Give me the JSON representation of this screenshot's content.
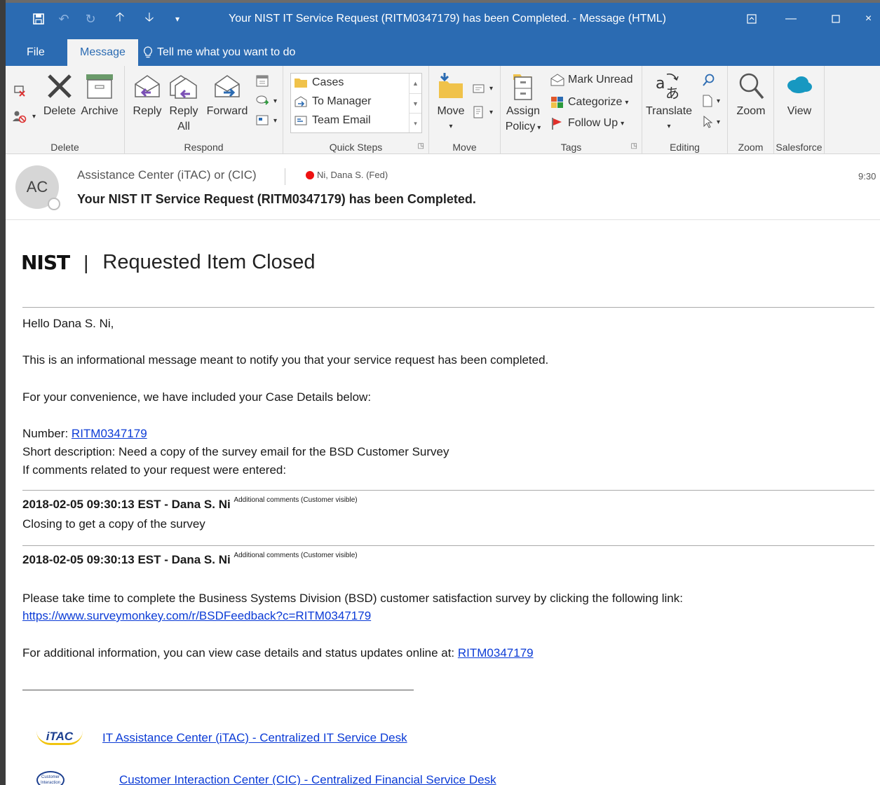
{
  "window": {
    "title": "Your NIST IT Service Request (RITM0347179) has been Completed.  -  Message (HTML)"
  },
  "tabs": {
    "file": "File",
    "message": "Message",
    "tell_me": "Tell me what you want to do"
  },
  "ribbon": {
    "delete_group": {
      "label": "Delete",
      "delete": "Delete",
      "archive": "Archive"
    },
    "respond_group": {
      "label": "Respond",
      "reply": "Reply",
      "reply_all_1": "Reply",
      "reply_all_2": "All",
      "forward": "Forward"
    },
    "quick_steps": {
      "label": "Quick Steps",
      "items": [
        "Cases",
        "To Manager",
        "Team Email"
      ]
    },
    "move_group": {
      "label": "Move",
      "move": "Move"
    },
    "tags_group": {
      "label": "Tags",
      "assign_1": "Assign",
      "assign_2": "Policy",
      "mark_unread": "Mark Unread",
      "categorize": "Categorize",
      "follow_up": "Follow Up"
    },
    "editing_group": {
      "label": "Editing",
      "translate": "Translate"
    },
    "zoom_group": {
      "label": "Zoom",
      "zoom": "Zoom"
    },
    "salesforce_group": {
      "label": "Salesforce",
      "view": "View"
    }
  },
  "header": {
    "avatar_initials": "AC",
    "sender": "Assistance Center (iTAC) or (CIC)",
    "recipient": "Ni, Dana S. (Fed)",
    "subject": "Your NIST IT Service Request (RITM0347179) has been Completed.",
    "time": "9:30"
  },
  "body": {
    "logo": "NIST",
    "separator": "|",
    "heading": "Requested Item Closed",
    "greeting": "Hello Dana S. Ni,",
    "intro": "This is an informational message meant to notify you that your service request has been completed.",
    "convenience": "For your convenience, we have included your Case Details below:",
    "number_label": "Number: ",
    "number": "RITM0347179",
    "short_description": "Short description: Need a copy of the survey email for the BSD Customer Survey",
    "comments_intro": "If comments related to your request were entered:",
    "comment1_header": "2018-02-05 09:30:13 EST - Dana S. Ni",
    "comment1_tag": "Additional comments (Customer visible)",
    "comment1_text": "Closing to get a copy of the survey",
    "comment2_header": "2018-02-05 09:30:13 EST - Dana S. Ni",
    "comment2_tag": "Additional comments (Customer visible)",
    "survey_text": "Please take time to complete the Business Systems Division (BSD) customer satisfaction survey by clicking the following link:",
    "survey_link": "https://www.surveymonkey.com/r/BSDFeedback?c=RITM0347179",
    "additional_info": "For additional information, you can view case details and status updates online at: ",
    "additional_link": "RITM0347179",
    "itac_logo": "iTAC",
    "itac_link": "IT Assistance Center (iTAC) - Centralized IT Service Desk",
    "cic_logo": "Customer Interaction Center",
    "cic_link": "Customer Interaction Center (CIC) - Centralized Financial Service Desk"
  }
}
